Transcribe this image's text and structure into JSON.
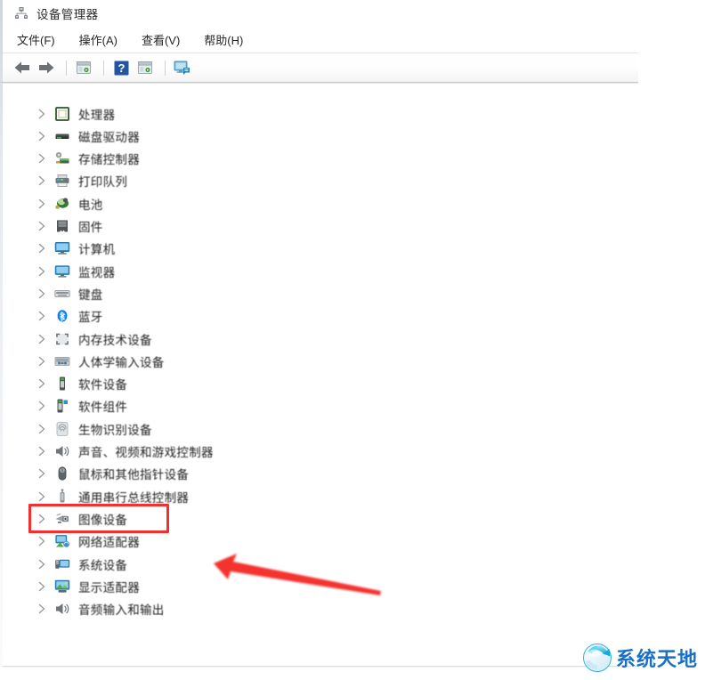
{
  "window": {
    "title": "设备管理器",
    "title_icon": "device-manager-icon"
  },
  "menu": {
    "items": [
      {
        "label": "文件(F)",
        "name": "menu-file"
      },
      {
        "label": "操作(A)",
        "name": "menu-action"
      },
      {
        "label": "查看(V)",
        "name": "menu-view"
      },
      {
        "label": "帮助(H)",
        "name": "menu-help"
      }
    ]
  },
  "toolbar": {
    "buttons": [
      {
        "name": "back-arrow-icon",
        "icon": "arrow-left"
      },
      {
        "name": "forward-arrow-icon",
        "icon": "arrow-right"
      },
      {
        "name": "separator-1",
        "icon": "separator"
      },
      {
        "name": "properties-icon",
        "icon": "panel"
      },
      {
        "name": "separator-2",
        "icon": "separator"
      },
      {
        "name": "help-icon",
        "icon": "question"
      },
      {
        "name": "show-hidden-devices-icon",
        "icon": "panel"
      },
      {
        "name": "separator-3",
        "icon": "separator"
      },
      {
        "name": "scan-hardware-changes-icon",
        "icon": "monitor-scan"
      }
    ]
  },
  "tree": {
    "items": [
      {
        "label": "处理器",
        "icon": "processor-icon"
      },
      {
        "label": "磁盘驱动器",
        "icon": "disk-drive-icon"
      },
      {
        "label": "存储控制器",
        "icon": "storage-controller-icon"
      },
      {
        "label": "打印队列",
        "icon": "print-queue-icon"
      },
      {
        "label": "电池",
        "icon": "battery-icon"
      },
      {
        "label": "固件",
        "icon": "firmware-icon"
      },
      {
        "label": "计算机",
        "icon": "computer-icon"
      },
      {
        "label": "监视器",
        "icon": "monitor-icon"
      },
      {
        "label": "键盘",
        "icon": "keyboard-icon"
      },
      {
        "label": "蓝牙",
        "icon": "bluetooth-icon"
      },
      {
        "label": "内存技术设备",
        "icon": "memory-technology-icon"
      },
      {
        "label": "人体学输入设备",
        "icon": "hid-icon"
      },
      {
        "label": "软件设备",
        "icon": "software-device-icon"
      },
      {
        "label": "软件组件",
        "icon": "software-component-icon"
      },
      {
        "label": "生物识别设备",
        "icon": "biometric-icon"
      },
      {
        "label": "声音、视频和游戏控制器",
        "icon": "sound-video-game-icon"
      },
      {
        "label": "鼠标和其他指针设备",
        "icon": "mouse-icon"
      },
      {
        "label": "通用串行总线控制器",
        "icon": "usb-controller-icon"
      },
      {
        "label": "图像设备",
        "icon": "imaging-device-icon"
      },
      {
        "label": "网络适配器",
        "icon": "network-adapter-icon"
      },
      {
        "label": "系统设备",
        "icon": "system-device-icon"
      },
      {
        "label": "显示适配器",
        "icon": "display-adapter-icon"
      },
      {
        "label": "音频输入和输出",
        "icon": "audio-io-icon"
      }
    ],
    "highlighted_index": 18,
    "expander_icon": "chevron-right-icon"
  },
  "annotations": {
    "highlight_color": "#f4302f",
    "arrow_color": "#f4302f",
    "highlight_target": "图像设备"
  },
  "watermark": {
    "text": "系统天地",
    "logo": "refresh-circle-logo",
    "color": "#1b6fc4"
  }
}
